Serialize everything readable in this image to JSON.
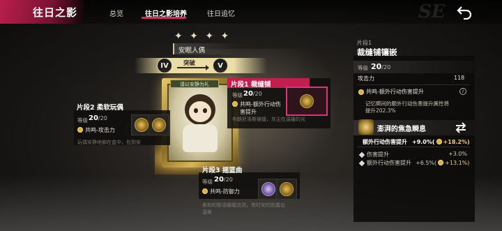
{
  "header": {
    "title": "往日之影",
    "tabs": [
      {
        "label": "总览",
        "active": false
      },
      {
        "label": "往日之影培养",
        "active": true
      },
      {
        "label": "往日追忆",
        "active": false
      }
    ]
  },
  "character": {
    "stars": "✦ ✦ ✦ ✦",
    "name": "安眠人偶",
    "rank_from": "IV",
    "rank_to": "V",
    "break_label": "突破",
    "portrait_tag": "请以安静为礼"
  },
  "segments": [
    {
      "title": "片段1  裁缝铺",
      "level_label": "等级",
      "level": "20",
      "level_max": "/20",
      "stat": "共鸣-额外行动伤害提升",
      "desc": "布朗尼洛斯被缝，灰尘在温暖的光",
      "selected": true
    },
    {
      "title": "片段2  柔软玩偶",
      "level_label": "等级",
      "level": "20",
      "level_max": "/20",
      "stat": "共鸣-攻击力",
      "desc": "玩偶安静地躺在盒中，包到安"
    },
    {
      "title": "片段3  摇篮曲",
      "level_label": "等级",
      "level": "20",
      "level_max": "/20",
      "stat": "共鸣-防御力",
      "desc": "柔和的歌谣缓缓流淌，有时安的脸露出",
      "desc2": "温柔"
    }
  ],
  "panel": {
    "subtitle": "片段1",
    "title": "裁缝铺镶嵌",
    "level_label": "等级",
    "level": "20",
    "level_max": "/20",
    "attack_label": "攻击力",
    "attack_value": "118",
    "resonance_name": "共鸣-额外行动伤害提升",
    "resonance_desc_1": "记忆瞬间的额外行动伤害提升属性将",
    "resonance_desc_2": "提升202.3%",
    "burst_title": "澎湃的焦急瞬息",
    "burst_main_label": "额外行动伤害提升",
    "burst_main_value": "+9.0%(",
    "burst_main_bonus": "+18.2%)",
    "lines": [
      {
        "label": "伤害提升",
        "value": "+3.0%",
        "bonus": ""
      },
      {
        "label": "额外行动伤害提升",
        "value": "+6.5%(",
        "bonus": "+13.1%)"
      }
    ]
  },
  "watermark": "SE",
  "colors": {
    "accent": "#c21e50",
    "gold": "#f2cd57"
  }
}
